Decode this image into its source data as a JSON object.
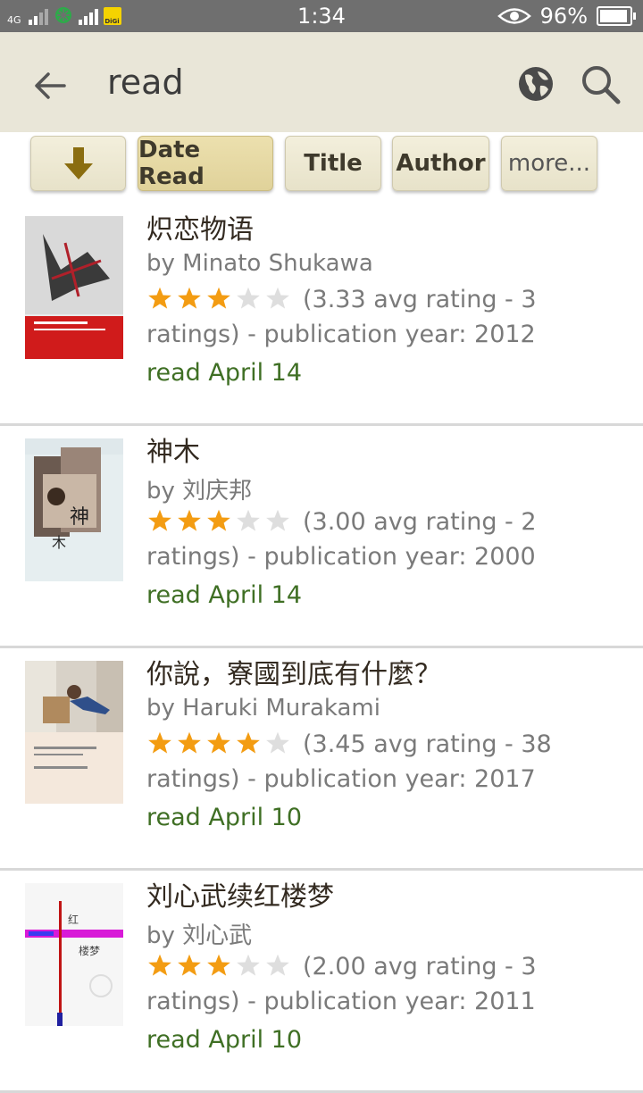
{
  "status_bar": {
    "time": "1:34",
    "network": "4G",
    "battery": "96%",
    "carrier_badge": "DiGi"
  },
  "app_bar": {
    "query": "read",
    "back_icon": "arrow-left-icon",
    "globe_icon": "globe-icon",
    "search_icon": "search-icon"
  },
  "sort_buttons": {
    "direction_icon": "arrow-down-icon",
    "date_read": "Date Read",
    "title": "Title",
    "author": "Author",
    "more": "more..."
  },
  "colors": {
    "app_bar_bg": "#e9e6d8",
    "read_text": "#3f6f24",
    "star": "#f39c12"
  },
  "books": [
    {
      "title": "炽恋物语",
      "author": "by Minato Shukawa",
      "stars": 3,
      "details": "(3.33 avg rating - 3 ratings) - publication year: 2012",
      "read": "read April 14"
    },
    {
      "title": "神木",
      "author": "by 刘庆邦",
      "stars": 3,
      "details": "(3.00 avg rating - 2 ratings) - publication year: 2000",
      "read": "read April 14"
    },
    {
      "title": "你說，寮國到底有什麼？",
      "author": "by Haruki Murakami",
      "stars": 4,
      "details": "(3.45 avg rating - 38 ratings) - publication year: 2017",
      "read": "read April 10"
    },
    {
      "title": "刘心武续红楼梦",
      "author": "by 刘心武",
      "stars": 3,
      "details": "(2.00 avg rating - 3 ratings) - publication year: 2011",
      "read": "read April 10"
    }
  ]
}
